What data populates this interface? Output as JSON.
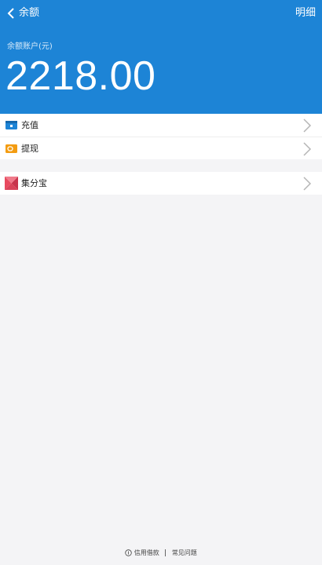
{
  "header": {
    "title": "余额",
    "detail_label": "明细",
    "account_label": "余额账户(元)",
    "balance": "2218.00",
    "color": "#1d84d6"
  },
  "actions": [
    {
      "label": "充值",
      "icon": "wallet-recharge-icon",
      "color": "#1d84d6"
    },
    {
      "label": "提现",
      "icon": "wallet-withdraw-icon",
      "color": "#f39c12"
    }
  ],
  "extras": [
    {
      "label": "集分宝",
      "icon": "jifenbao-icon",
      "color": "#e84a5f"
    }
  ],
  "footer": {
    "agreement": "信用借款",
    "faq": "常见问题"
  }
}
